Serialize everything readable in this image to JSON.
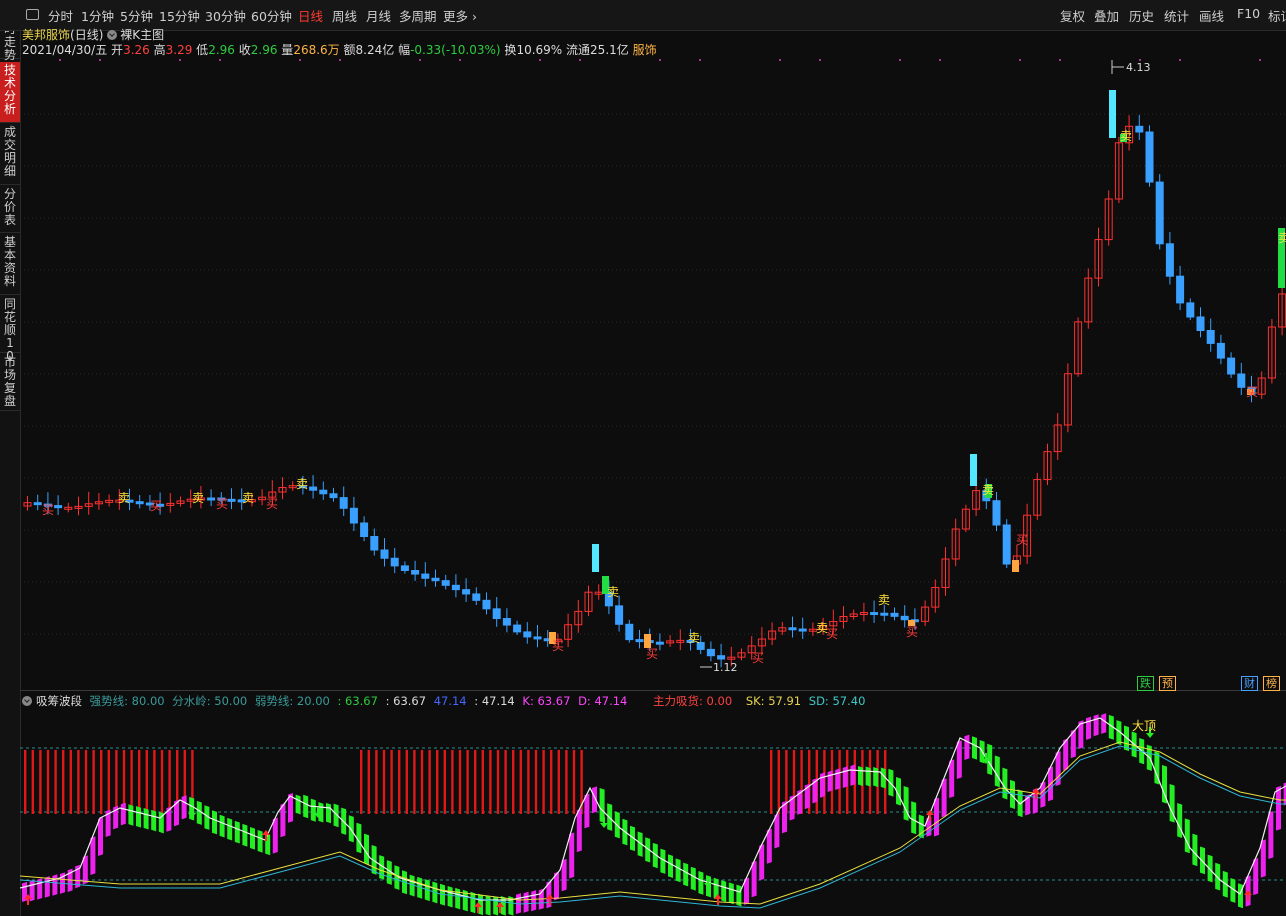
{
  "toolbar": {
    "left": [
      "分时",
      "1分钟",
      "5分钟",
      "15分钟",
      "30分钟",
      "60分钟",
      "日线",
      "周线",
      "月线",
      "多周期",
      "更多"
    ],
    "active": "日线",
    "right": [
      "复权",
      "叠加",
      "历史",
      "统计",
      "画线",
      "F10",
      "标记"
    ]
  },
  "sidebar": [
    {
      "label": "分时走势",
      "active": false
    },
    {
      "label": "技术分析",
      "active": true
    },
    {
      "label": "成交明细",
      "active": false
    },
    {
      "label": "分价表",
      "active": false
    },
    {
      "label": "基本资料",
      "active": false
    },
    {
      "label": "同花顺10",
      "active": false
    },
    {
      "label": "市场复盘",
      "active": false
    }
  ],
  "stock": {
    "name": "美邦服饰",
    "period": "(日线)",
    "main_chart_label": "裸K主图",
    "date": "2021/04/30/五",
    "open_label": "开",
    "open": "3.26",
    "high_label": "高",
    "high": "3.29",
    "low_label": "低",
    "low": "2.96",
    "close_label": "收",
    "close": "2.96",
    "vol_label": "量",
    "vol": "268.6万",
    "amt_label": "额",
    "amt": "8.24亿",
    "chg_label": "幅",
    "chg": "-0.33(-10.03%)",
    "turn_label": "换",
    "turn": "10.69%",
    "float_label": "流通",
    "float": "25.1亿",
    "sector": "服饰"
  },
  "price_labels": {
    "max": "4.13",
    "min": "1.12"
  },
  "signals": {
    "buy": "买",
    "sell": "卖",
    "top": "大顶"
  },
  "badges": [
    {
      "label": "跌",
      "color": "#2ecc40"
    },
    {
      "label": "预",
      "color": "#ffb347"
    },
    {
      "label": "财",
      "color": "#4aa0ff"
    },
    {
      "label": "榜",
      "color": "#ffb347"
    }
  ],
  "indicator": {
    "name": "吸筹波段",
    "strong": "强势线: 80.00",
    "water": "分水岭: 50.00",
    "weak": "弱势线: 20.00",
    "v1": ": 63.67",
    "v2": ": 63.67",
    "v3": "47.14",
    "v4": ": 47.14",
    "k": "K: 63.67",
    "d": "D: 47.14",
    "main": "主力吸货: 0.00",
    "sk": "SK: 57.91",
    "sd": "SD: 57.40"
  },
  "colors": {
    "up": "#ff3030",
    "down": "#3aa0ff",
    "bg": "#0d0d0d",
    "accent": "#c81e1e"
  },
  "icons": [
    "window-icon",
    "chevron-right-icon",
    "toggle-circle-icon"
  ]
}
